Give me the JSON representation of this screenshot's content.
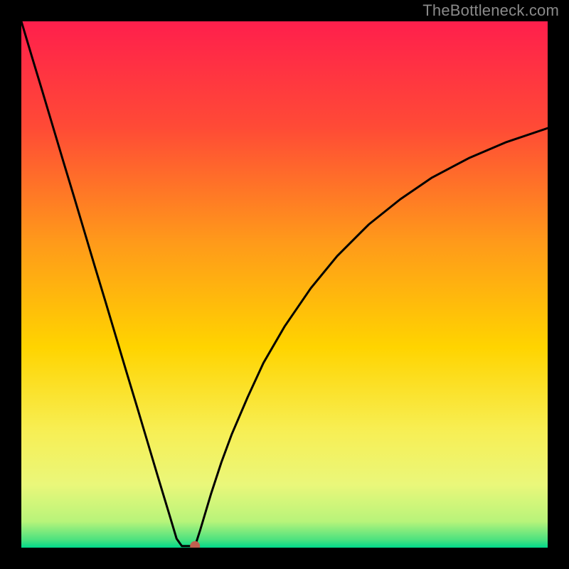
{
  "watermark": "TheBottleneck.com",
  "chart_data": {
    "type": "line",
    "title": "",
    "xlabel": "",
    "ylabel": "",
    "xlim": [
      0,
      100
    ],
    "ylim": [
      0,
      100
    ],
    "grid": false,
    "legend": false,
    "background_gradient": {
      "stops": [
        {
          "offset": 0.0,
          "color": "#ff1f4c"
        },
        {
          "offset": 0.2,
          "color": "#ff4a36"
        },
        {
          "offset": 0.42,
          "color": "#ff9a1a"
        },
        {
          "offset": 0.62,
          "color": "#ffd400"
        },
        {
          "offset": 0.78,
          "color": "#f7ef55"
        },
        {
          "offset": 0.88,
          "color": "#eaf77a"
        },
        {
          "offset": 0.95,
          "color": "#b8f47a"
        },
        {
          "offset": 0.985,
          "color": "#4ce27f"
        },
        {
          "offset": 1.0,
          "color": "#00d98a"
        }
      ]
    },
    "series": [
      {
        "name": "left-branch",
        "x": [
          0.0,
          2.0,
          4.0,
          6.0,
          8.0,
          10.0,
          12.0,
          14.0,
          16.0,
          18.0,
          20.0,
          22.0,
          24.0,
          26.0,
          28.0,
          29.5,
          30.5,
          31.5,
          33.0
        ],
        "y": [
          100.0,
          93.3,
          86.7,
          80.0,
          73.3,
          66.7,
          60.0,
          53.3,
          46.7,
          40.0,
          33.3,
          26.7,
          20.0,
          13.3,
          6.7,
          1.7,
          0.3,
          0.3,
          0.3
        ]
      },
      {
        "name": "right-branch",
        "x": [
          33.0,
          34.0,
          36.0,
          38.0,
          40.0,
          43.0,
          46.0,
          50.0,
          55.0,
          60.0,
          66.0,
          72.0,
          78.0,
          85.0,
          92.0,
          100.0
        ],
        "y": [
          0.3,
          3.4,
          10.1,
          16.2,
          21.6,
          28.6,
          35.1,
          42.0,
          49.3,
          55.4,
          61.4,
          66.2,
          70.3,
          74.0,
          77.0,
          79.7
        ]
      }
    ],
    "marker": {
      "x": 33.0,
      "y": 0.3,
      "color": "#c06050",
      "radius_px": 7
    }
  }
}
